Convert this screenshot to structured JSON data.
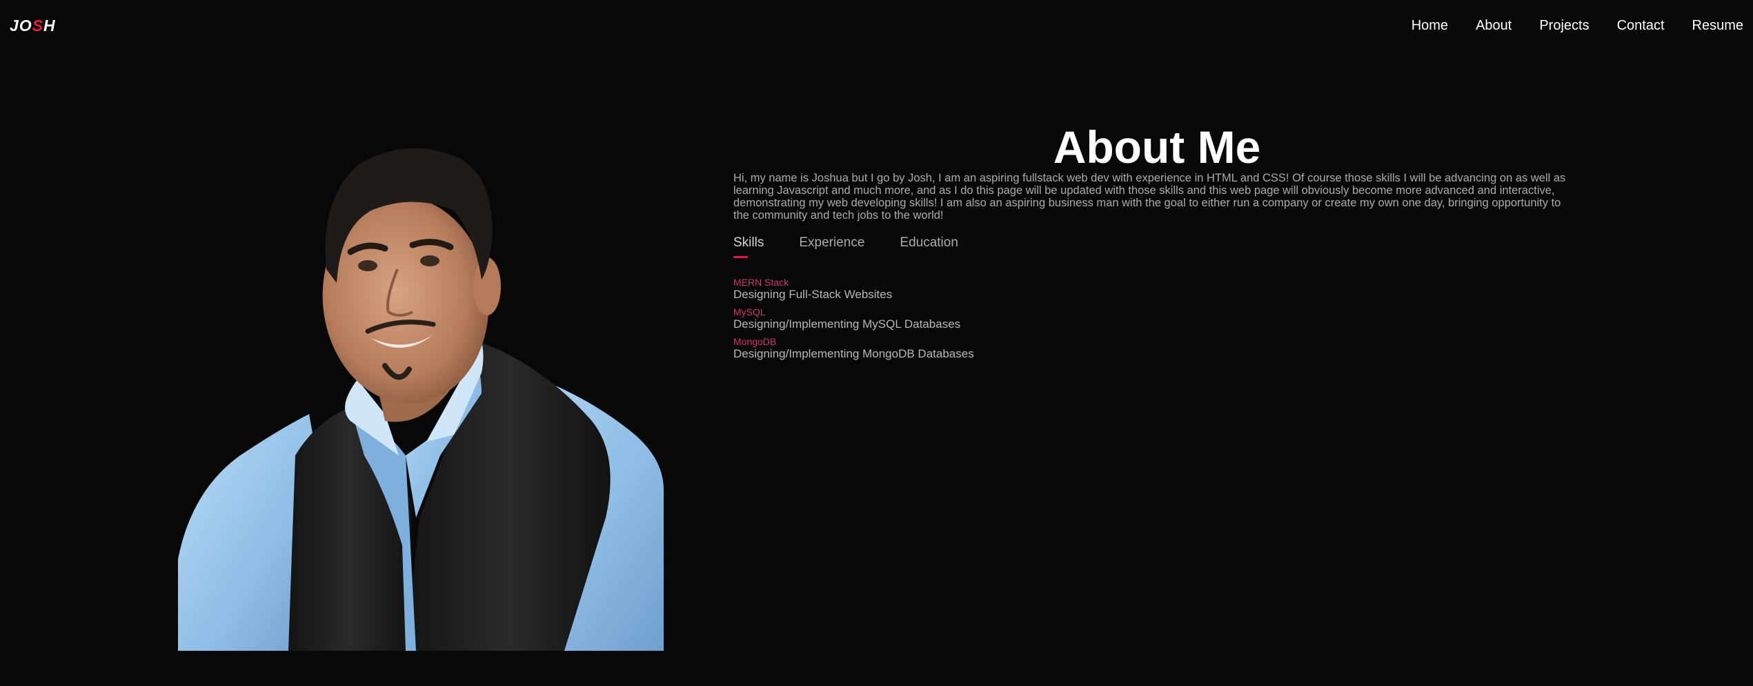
{
  "header": {
    "logo": {
      "pre": "JO",
      "accent": "S",
      "post": "H"
    },
    "nav": [
      "Home",
      "About",
      "Projects",
      "Contact",
      "Resume"
    ]
  },
  "portrait": {
    "subject": "portrait photo of a smiling man in a light blue shirt and dark vest",
    "colors": {
      "shirt": "#9ec9ee",
      "vest": "#1c1c1c",
      "skin": "#c49070",
      "hair": "#1f1b18",
      "background": "#080808"
    }
  },
  "about": {
    "title": "About Me",
    "text": "Hi, my name is Joshua but I go by Josh, I am an aspiring fullstack web dev with experience in HTML and CSS! Of course those skills I will be advancing on as well as learning Javascript and much more, and as I do this page will be updated with those skills and this web page will obviously become more advanced and interactive, demonstrating my web developing skills! I am also an aspiring business man with the goal to either run a company or create my own one day, bringing opportunity to the community and tech jobs to the world!",
    "tabs": [
      "Skills",
      "Experience",
      "Education"
    ],
    "active_tab": "Skills",
    "skills": [
      {
        "name": "MERN Stack",
        "desc": "Designing Full-Stack Websites"
      },
      {
        "name": "MySQL",
        "desc": "Designing/Implementing MySQL Databases"
      },
      {
        "name": "MongoDB",
        "desc": "Designing/Implementing MongoDB Databases"
      }
    ]
  },
  "colors": {
    "background": "#080808",
    "accent": "#e6194b",
    "skill_name": "#c83c67",
    "nav_text": "#ffffff",
    "body_text": "#ababab"
  }
}
